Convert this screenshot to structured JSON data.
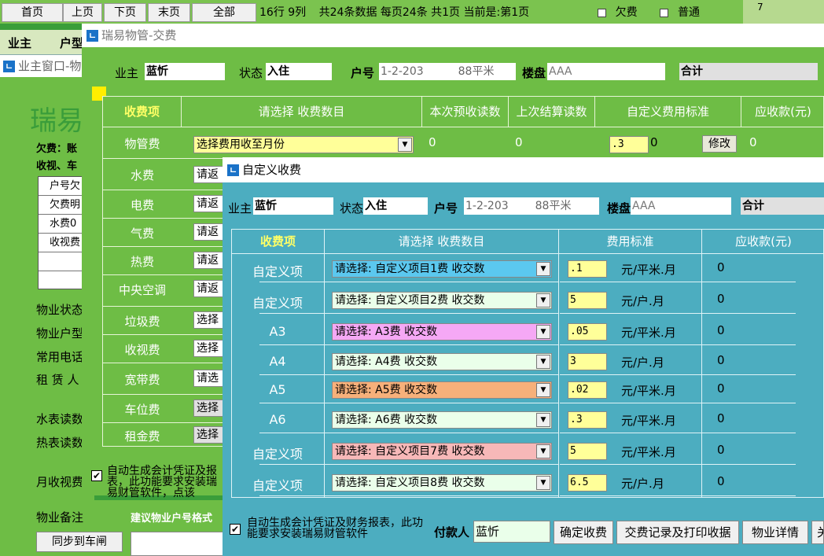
{
  "topbar": {
    "nav": [
      "首页",
      "上页",
      "下页",
      "末页",
      "全部"
    ],
    "rows_cols": "16行 9列",
    "summary": "共24条数据 每页24条 共1页 当前是:第1页",
    "check_arrears": "欠费",
    "check_normal": "普通",
    "right_value": "7"
  },
  "secondbar": {
    "owner": "业主",
    "type": "户型"
  },
  "leftwin": {
    "title": "业主窗口-物",
    "brand": "瑞易",
    "arrears_line": "欠费：账",
    "arrears_line2": "收视、车",
    "table": [
      "户号欠",
      "欠费明",
      "水费0",
      "收视费",
      "",
      ""
    ],
    "items": [
      "物业状态",
      "物业户型",
      "常用电话",
      "租 赁 人",
      "水表读数",
      "热表读数",
      "月收视费",
      "物业备注"
    ],
    "bottom_hint": "建议物业户号格式",
    "sync_button": "同步到车闸"
  },
  "mainwin": {
    "title": "瑞易物管-交费",
    "owner_label": "业主",
    "owner_value": "蓝忻",
    "status_label": "状态",
    "status_value": "入住",
    "unit_label": "户号",
    "unit_value": "1-2-203",
    "area_value": "88平米",
    "building_label": "楼盘",
    "building_value": "AAA",
    "total_label": "合计",
    "headers": [
      "收费项",
      "请选择 收费数目",
      "本次预收读数",
      "上次结算读数",
      "自定义费用标准",
      "应收款(元)"
    ],
    "rows": [
      {
        "name": "物管费",
        "select": "选择费用收至月份",
        "cur": "0",
        "last": "0",
        "std": ".3",
        "std2": "0",
        "edit": "修改",
        "due": "0"
      },
      {
        "name": "水费",
        "select": "请返"
      },
      {
        "name": "电费",
        "select": "请返"
      },
      {
        "name": "气费",
        "select": "请返"
      },
      {
        "name": "热费",
        "select": "请返"
      },
      {
        "name": "中央空调",
        "select": "请返"
      },
      {
        "name": "垃圾费",
        "select": "选择"
      },
      {
        "name": "收视费",
        "select": "选择"
      },
      {
        "name": "宽带费",
        "select": "请选"
      },
      {
        "name": "车位费",
        "select": "选择"
      },
      {
        "name": "租金费",
        "select": "选择"
      }
    ],
    "footer": "自动生成会计凭证及报表，此功能要求安装瑞易财管软件，点该"
  },
  "dialog": {
    "title": "自定义收费",
    "owner_label": "业主",
    "owner_value": "蓝忻",
    "status_label": "状态",
    "status_value": "入住",
    "unit_label": "户号",
    "unit_value": "1-2-203",
    "area_value": "88平米",
    "building_label": "楼盘",
    "building_value": "AAA",
    "total_label": "合计",
    "headers": [
      "收费项",
      "请选择 收费数目",
      "费用标准",
      "应收款(元)"
    ],
    "rows": [
      {
        "name": "自定义项",
        "select": "请选择: 自定义项目1费 收交数",
        "color": "#5bc8ef",
        "std": ".1",
        "unit": "元/平米.月",
        "due": "0"
      },
      {
        "name": "自定义项",
        "select": "请选择: 自定义项目2费 收交数",
        "color": "#eaffea",
        "std": "5",
        "unit": "元/户.月",
        "due": "0"
      },
      {
        "name": "A3",
        "select": "请选择: A3费 收交数",
        "color": "#f5a8f5",
        "std": ".05",
        "unit": "元/平米.月",
        "due": "0"
      },
      {
        "name": "A4",
        "select": "请选择: A4费 收交数",
        "color": "#eaffea",
        "std": "3",
        "unit": "元/户.月",
        "due": "0"
      },
      {
        "name": "A5",
        "select": "请选择: A5费 收交数",
        "color": "#f7b07a",
        "std": ".02",
        "unit": "元/平米.月",
        "due": "0"
      },
      {
        "name": "A6",
        "select": "请选择: A6费 收交数",
        "color": "#eaffea",
        "std": ".3",
        "unit": "元/平米.月",
        "due": "0"
      },
      {
        "name": "自定义项",
        "select": "请选择: 自定义项目7费 收交数",
        "color": "#f7b8b8",
        "std": "5",
        "unit": "元/平米.月",
        "due": "0"
      },
      {
        "name": "自定义项",
        "select": "请选择: 自定义项目8费 收交数",
        "color": "#eaffea",
        "std": "6.5",
        "unit": "元/户.月",
        "due": "0"
      }
    ],
    "footer": "自动生成会计凭证及财务报表，此功能要求安装瑞易财管软件",
    "payer_label": "付款人",
    "payer_value": "蓝忻",
    "buttons": [
      "确定收费",
      "交费记录及打印收据",
      "物业详情",
      "关"
    ]
  }
}
